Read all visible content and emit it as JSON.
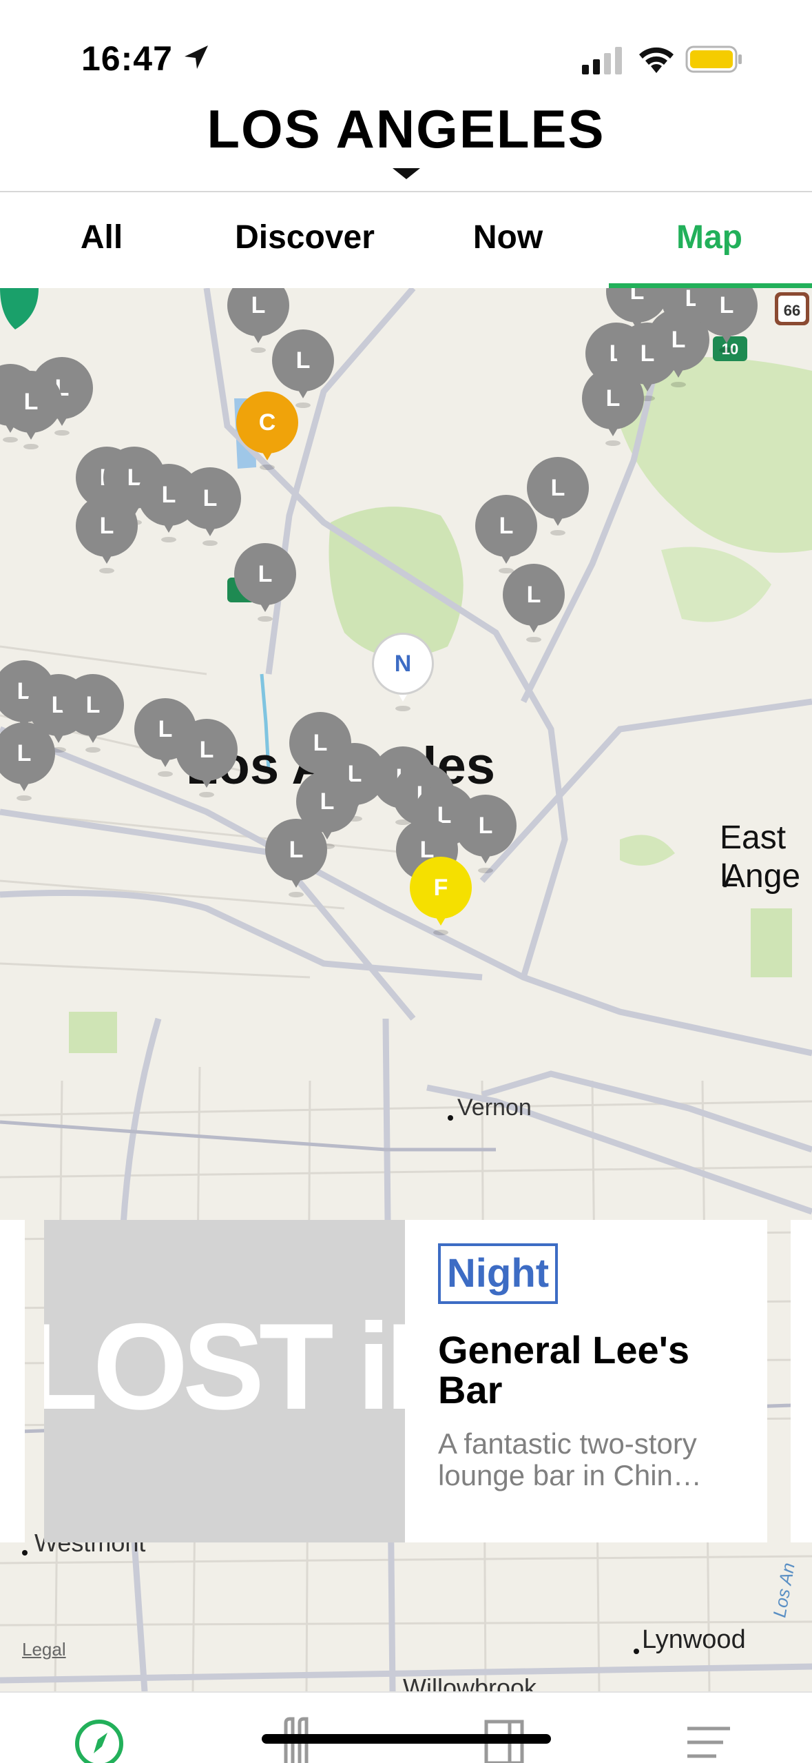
{
  "status_bar": {
    "time": "16:47"
  },
  "header": {
    "city": "LOS ANGELES"
  },
  "tabs": [
    {
      "label": "All",
      "active": false
    },
    {
      "label": "Discover",
      "active": false
    },
    {
      "label": "Now",
      "active": false
    },
    {
      "label": "Map",
      "active": true
    }
  ],
  "map": {
    "labels": {
      "city": "Los Angeles",
      "east_la_1": "East L",
      "east_la_2": "Ange",
      "vernon": "Vernon",
      "westmont": "Westmont",
      "lynwood": "Lynwood",
      "willowbrook": "Willowbrook",
      "los_angeles_river": "Los An",
      "legal": "Legal",
      "shield_66": "66",
      "shield_10": "10"
    },
    "pin_colors": {
      "L": "#8a8a8a",
      "C": "#f0a30a",
      "F": "#f5e000",
      "N": "#ffffff"
    },
    "pins": [
      "L",
      "L",
      "L",
      "L",
      "L",
      "L",
      "L",
      "L",
      "L",
      "L",
      "L",
      "L",
      "L",
      "L",
      "L",
      "L",
      "L",
      "L",
      "L",
      "L",
      "L",
      "L",
      "L",
      "L",
      "L",
      "L",
      "L",
      "L",
      "L",
      "L",
      "L",
      "L",
      "L",
      "L",
      "L",
      "L",
      "C",
      "N",
      "F"
    ]
  },
  "card": {
    "image_text": "LOST iN",
    "badge": "Night",
    "title": "General Lee's Bar",
    "description": "A fantastic two-story lounge bar in Chin…"
  },
  "colors": {
    "accent": "#22b05a",
    "badge": "#3d6cc4"
  },
  "icons": [
    "location-arrow-icon",
    "signal-icon",
    "wifi-icon",
    "battery-icon",
    "caret-down-icon",
    "locate-icon",
    "compass-icon",
    "guide-icon",
    "book-icon",
    "menu-icon"
  ]
}
